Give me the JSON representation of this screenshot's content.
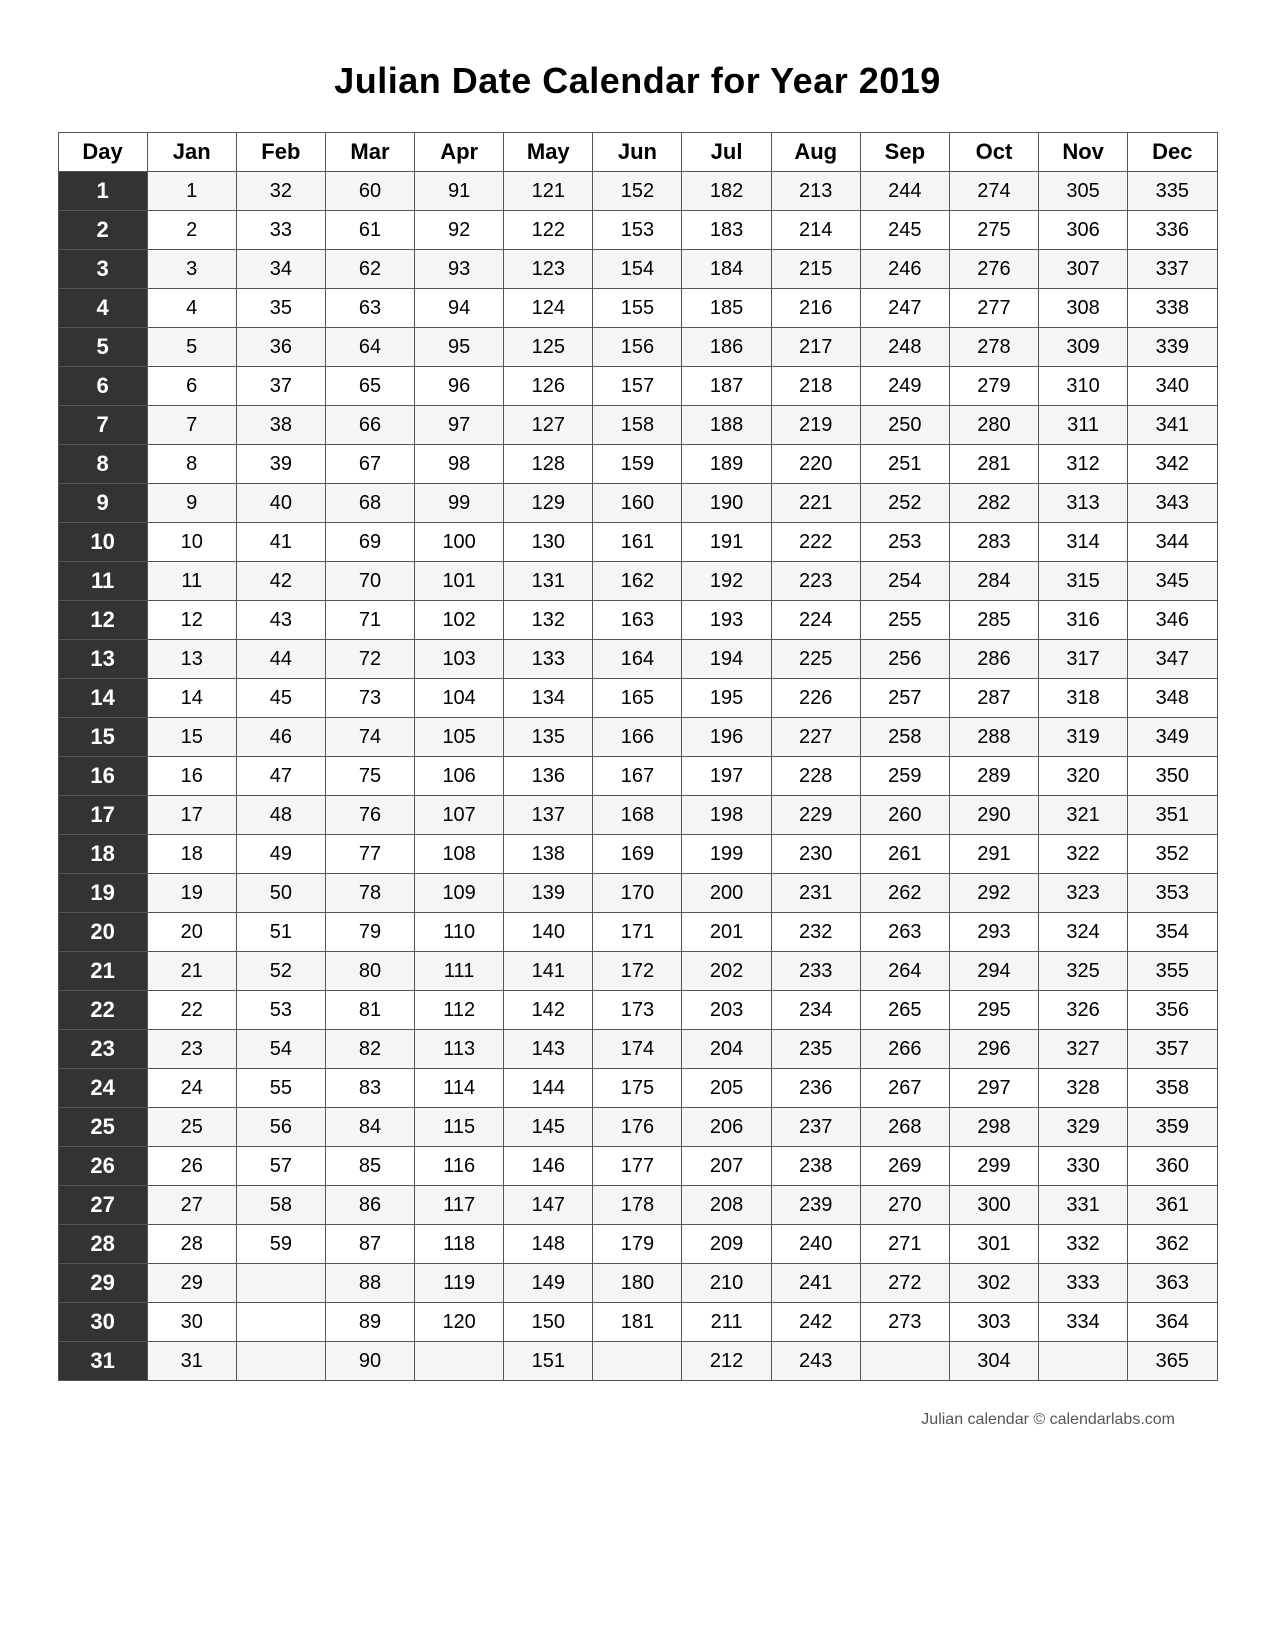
{
  "title": "Julian Date Calendar for Year 2019",
  "headers": [
    "Day",
    "Jan",
    "Feb",
    "Mar",
    "Apr",
    "May",
    "Jun",
    "Jul",
    "Aug",
    "Sep",
    "Oct",
    "Nov",
    "Dec"
  ],
  "rows": [
    {
      "day": "1",
      "jan": "1",
      "feb": "32",
      "mar": "60",
      "apr": "91",
      "may": "121",
      "jun": "152",
      "jul": "182",
      "aug": "213",
      "sep": "244",
      "oct": "274",
      "nov": "305",
      "dec": "335"
    },
    {
      "day": "2",
      "jan": "2",
      "feb": "33",
      "mar": "61",
      "apr": "92",
      "may": "122",
      "jun": "153",
      "jul": "183",
      "aug": "214",
      "sep": "245",
      "oct": "275",
      "nov": "306",
      "dec": "336"
    },
    {
      "day": "3",
      "jan": "3",
      "feb": "34",
      "mar": "62",
      "apr": "93",
      "may": "123",
      "jun": "154",
      "jul": "184",
      "aug": "215",
      "sep": "246",
      "oct": "276",
      "nov": "307",
      "dec": "337"
    },
    {
      "day": "4",
      "jan": "4",
      "feb": "35",
      "mar": "63",
      "apr": "94",
      "may": "124",
      "jun": "155",
      "jul": "185",
      "aug": "216",
      "sep": "247",
      "oct": "277",
      "nov": "308",
      "dec": "338"
    },
    {
      "day": "5",
      "jan": "5",
      "feb": "36",
      "mar": "64",
      "apr": "95",
      "may": "125",
      "jun": "156",
      "jul": "186",
      "aug": "217",
      "sep": "248",
      "oct": "278",
      "nov": "309",
      "dec": "339"
    },
    {
      "day": "6",
      "jan": "6",
      "feb": "37",
      "mar": "65",
      "apr": "96",
      "may": "126",
      "jun": "157",
      "jul": "187",
      "aug": "218",
      "sep": "249",
      "oct": "279",
      "nov": "310",
      "dec": "340"
    },
    {
      "day": "7",
      "jan": "7",
      "feb": "38",
      "mar": "66",
      "apr": "97",
      "may": "127",
      "jun": "158",
      "jul": "188",
      "aug": "219",
      "sep": "250",
      "oct": "280",
      "nov": "311",
      "dec": "341"
    },
    {
      "day": "8",
      "jan": "8",
      "feb": "39",
      "mar": "67",
      "apr": "98",
      "may": "128",
      "jun": "159",
      "jul": "189",
      "aug": "220",
      "sep": "251",
      "oct": "281",
      "nov": "312",
      "dec": "342"
    },
    {
      "day": "9",
      "jan": "9",
      "feb": "40",
      "mar": "68",
      "apr": "99",
      "may": "129",
      "jun": "160",
      "jul": "190",
      "aug": "221",
      "sep": "252",
      "oct": "282",
      "nov": "313",
      "dec": "343"
    },
    {
      "day": "10",
      "jan": "10",
      "feb": "41",
      "mar": "69",
      "apr": "100",
      "may": "130",
      "jun": "161",
      "jul": "191",
      "aug": "222",
      "sep": "253",
      "oct": "283",
      "nov": "314",
      "dec": "344"
    },
    {
      "day": "11",
      "jan": "11",
      "feb": "42",
      "mar": "70",
      "apr": "101",
      "may": "131",
      "jun": "162",
      "jul": "192",
      "aug": "223",
      "sep": "254",
      "oct": "284",
      "nov": "315",
      "dec": "345"
    },
    {
      "day": "12",
      "jan": "12",
      "feb": "43",
      "mar": "71",
      "apr": "102",
      "may": "132",
      "jun": "163",
      "jul": "193",
      "aug": "224",
      "sep": "255",
      "oct": "285",
      "nov": "316",
      "dec": "346"
    },
    {
      "day": "13",
      "jan": "13",
      "feb": "44",
      "mar": "72",
      "apr": "103",
      "may": "133",
      "jun": "164",
      "jul": "194",
      "aug": "225",
      "sep": "256",
      "oct": "286",
      "nov": "317",
      "dec": "347"
    },
    {
      "day": "14",
      "jan": "14",
      "feb": "45",
      "mar": "73",
      "apr": "104",
      "may": "134",
      "jun": "165",
      "jul": "195",
      "aug": "226",
      "sep": "257",
      "oct": "287",
      "nov": "318",
      "dec": "348"
    },
    {
      "day": "15",
      "jan": "15",
      "feb": "46",
      "mar": "74",
      "apr": "105",
      "may": "135",
      "jun": "166",
      "jul": "196",
      "aug": "227",
      "sep": "258",
      "oct": "288",
      "nov": "319",
      "dec": "349"
    },
    {
      "day": "16",
      "jan": "16",
      "feb": "47",
      "mar": "75",
      "apr": "106",
      "may": "136",
      "jun": "167",
      "jul": "197",
      "aug": "228",
      "sep": "259",
      "oct": "289",
      "nov": "320",
      "dec": "350"
    },
    {
      "day": "17",
      "jan": "17",
      "feb": "48",
      "mar": "76",
      "apr": "107",
      "may": "137",
      "jun": "168",
      "jul": "198",
      "aug": "229",
      "sep": "260",
      "oct": "290",
      "nov": "321",
      "dec": "351"
    },
    {
      "day": "18",
      "jan": "18",
      "feb": "49",
      "mar": "77",
      "apr": "108",
      "may": "138",
      "jun": "169",
      "jul": "199",
      "aug": "230",
      "sep": "261",
      "oct": "291",
      "nov": "322",
      "dec": "352"
    },
    {
      "day": "19",
      "jan": "19",
      "feb": "50",
      "mar": "78",
      "apr": "109",
      "may": "139",
      "jun": "170",
      "jul": "200",
      "aug": "231",
      "sep": "262",
      "oct": "292",
      "nov": "323",
      "dec": "353"
    },
    {
      "day": "20",
      "jan": "20",
      "feb": "51",
      "mar": "79",
      "apr": "110",
      "may": "140",
      "jun": "171",
      "jul": "201",
      "aug": "232",
      "sep": "263",
      "oct": "293",
      "nov": "324",
      "dec": "354"
    },
    {
      "day": "21",
      "jan": "21",
      "feb": "52",
      "mar": "80",
      "apr": "111",
      "may": "141",
      "jun": "172",
      "jul": "202",
      "aug": "233",
      "sep": "264",
      "oct": "294",
      "nov": "325",
      "dec": "355"
    },
    {
      "day": "22",
      "jan": "22",
      "feb": "53",
      "mar": "81",
      "apr": "112",
      "may": "142",
      "jun": "173",
      "jul": "203",
      "aug": "234",
      "sep": "265",
      "oct": "295",
      "nov": "326",
      "dec": "356"
    },
    {
      "day": "23",
      "jan": "23",
      "feb": "54",
      "mar": "82",
      "apr": "113",
      "may": "143",
      "jun": "174",
      "jul": "204",
      "aug": "235",
      "sep": "266",
      "oct": "296",
      "nov": "327",
      "dec": "357"
    },
    {
      "day": "24",
      "jan": "24",
      "feb": "55",
      "mar": "83",
      "apr": "114",
      "may": "144",
      "jun": "175",
      "jul": "205",
      "aug": "236",
      "sep": "267",
      "oct": "297",
      "nov": "328",
      "dec": "358"
    },
    {
      "day": "25",
      "jan": "25",
      "feb": "56",
      "mar": "84",
      "apr": "115",
      "may": "145",
      "jun": "176",
      "jul": "206",
      "aug": "237",
      "sep": "268",
      "oct": "298",
      "nov": "329",
      "dec": "359"
    },
    {
      "day": "26",
      "jan": "26",
      "feb": "57",
      "mar": "85",
      "apr": "116",
      "may": "146",
      "jun": "177",
      "jul": "207",
      "aug": "238",
      "sep": "269",
      "oct": "299",
      "nov": "330",
      "dec": "360"
    },
    {
      "day": "27",
      "jan": "27",
      "feb": "58",
      "mar": "86",
      "apr": "117",
      "may": "147",
      "jun": "178",
      "jul": "208",
      "aug": "239",
      "sep": "270",
      "oct": "300",
      "nov": "331",
      "dec": "361"
    },
    {
      "day": "28",
      "jan": "28",
      "feb": "59",
      "mar": "87",
      "apr": "118",
      "may": "148",
      "jun": "179",
      "jul": "209",
      "aug": "240",
      "sep": "271",
      "oct": "301",
      "nov": "332",
      "dec": "362"
    },
    {
      "day": "29",
      "jan": "29",
      "feb": "",
      "mar": "88",
      "apr": "119",
      "may": "149",
      "jun": "180",
      "jul": "210",
      "aug": "241",
      "sep": "272",
      "oct": "302",
      "nov": "333",
      "dec": "363"
    },
    {
      "day": "30",
      "jan": "30",
      "feb": "",
      "mar": "89",
      "apr": "120",
      "may": "150",
      "jun": "181",
      "jul": "211",
      "aug": "242",
      "sep": "273",
      "oct": "303",
      "nov": "334",
      "dec": "364"
    },
    {
      "day": "31",
      "jan": "31",
      "feb": "",
      "mar": "90",
      "apr": "",
      "may": "151",
      "jun": "",
      "jul": "212",
      "aug": "243",
      "sep": "",
      "oct": "304",
      "nov": "",
      "dec": "365"
    }
  ],
  "footer": "Julian calendar © calendarlabs.com"
}
